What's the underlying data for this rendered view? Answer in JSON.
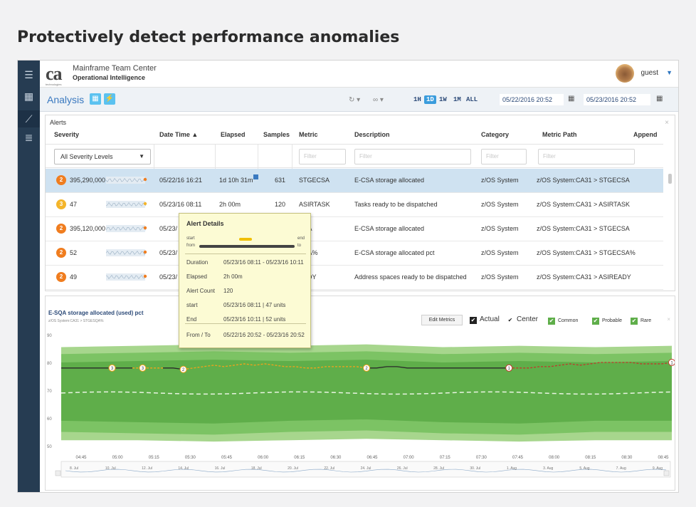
{
  "headline": "Protectively detect performance anomalies",
  "app": {
    "logo": "ca",
    "logo_sub": "technologies",
    "title_line1": "Mainframe Team Center",
    "title_line2": "Operational Intelligence",
    "user": "guest",
    "nav_icons": [
      "menu-icon",
      "grid-icon",
      "line-chart-icon",
      "filter-list-icon"
    ]
  },
  "subbar": {
    "title": "Analysis",
    "ranges": [
      "1H",
      "1D",
      "1W",
      "1M",
      "ALL"
    ],
    "active_range": "1D",
    "date_from": "05/22/2016 20:52",
    "date_to": "05/23/2016 20:52",
    "colors": {
      "accent": "#3a79c0",
      "active_range_bg": "#3a9cdc"
    }
  },
  "alerts": {
    "title": "Alerts",
    "columns": [
      "Severity",
      "Date Time",
      "Elapsed",
      "Samples",
      "Metric",
      "Description",
      "Category",
      "Metric Path",
      "Append"
    ],
    "sort_indicator": "▲",
    "severity_filter": "All Severity Levels",
    "filter_placeholder": "Filter",
    "rows": [
      {
        "level": "2",
        "value": "395,290,000",
        "datetime": "05/22/16 16:21",
        "elapsed": "1d 10h 31m",
        "samples": "631",
        "metric": "STGECSA",
        "description": "E-CSA storage allocated",
        "category": "z/OS System",
        "path": "z/OS System:CA31 > STGECSA"
      },
      {
        "level": "3",
        "value": "47",
        "datetime": "05/23/16 08:11",
        "elapsed": "2h 00m",
        "samples": "120",
        "metric": "ASIRTASK",
        "description": "Tasks ready to be dispatched",
        "category": "z/OS System",
        "path": "z/OS System:CA31 > ASIRTASK"
      },
      {
        "level": "2",
        "value": "395,120,000",
        "datetime": "05/23/",
        "elapsed": "",
        "samples": "",
        "metric": "CSA",
        "description": "E-CSA storage allocated",
        "category": "z/OS System",
        "path": "z/OS System:CA31 > STGECSA"
      },
      {
        "level": "2",
        "value": "52",
        "datetime": "05/23/",
        "elapsed": "",
        "samples": "",
        "metric": "CSA%",
        "description": "E-CSA storage allocated pct",
        "category": "z/OS System",
        "path": "z/OS System:CA31 > STGECSA%"
      },
      {
        "level": "2",
        "value": "49",
        "datetime": "05/23/",
        "elapsed": "",
        "samples": "",
        "metric": "EADY",
        "description": "Address spaces ready to be dispatched",
        "category": "z/OS System",
        "path": "z/OS System:CA31 > ASIREADY"
      }
    ],
    "severity_colors": {
      "2": "#f07d1f",
      "3": "#f4b52b"
    }
  },
  "alert_details": {
    "title": "Alert Details",
    "scale": {
      "start": "start",
      "from": "from",
      "end": "end",
      "to": "to"
    },
    "rows": [
      {
        "label": "Duration",
        "value": "05/23/16 08:11  - 05/23/16 10:11"
      },
      {
        "label": "Elapsed",
        "value": "2h 00m"
      },
      {
        "label": "Alert Count",
        "value": "120"
      },
      {
        "label": "start",
        "value": "05/23/16 08:11  |  47 units"
      },
      {
        "label": "End",
        "value": "05/23/16 10:11  |  52 units"
      },
      {
        "label": "From / To",
        "value": "05/22/16 20:52  - 05/23/16 20:52"
      }
    ]
  },
  "chart": {
    "title": "E-SQA storage allocated (used) pct",
    "subtitle": "z/OS System:CA31 > STGESQA%",
    "edit_label": "Edit Metrics",
    "legend": {
      "actual": "Actual",
      "center": "Center",
      "common": "Common",
      "probable": "Probable",
      "rare": "Rare"
    },
    "close": "×"
  },
  "chart_data": {
    "type": "line",
    "ylim": [
      50,
      90
    ],
    "yticks": [
      "90",
      "80",
      "70",
      "60",
      "50"
    ],
    "xticks": [
      "04:45",
      "05:00",
      "05:15",
      "05:30",
      "05:45",
      "06:00",
      "06:15",
      "06:30",
      "06:45",
      "07:00",
      "07:15",
      "07:30",
      "07:45",
      "08:00",
      "08:15",
      "08:30",
      "08:45"
    ],
    "overview_ticks": [
      "8. Jul",
      "10. Jul",
      "12. Jul",
      "14. Jul",
      "16. Jul",
      "18. Jul",
      "20. Jul",
      "22. Jul",
      "24. Jul",
      "26. Jul",
      "28. Jul",
      "30. Jul",
      "1. Aug",
      "3. Aug",
      "5. Aug",
      "7. Aug",
      "9. Aug"
    ],
    "actual": [
      78,
      78,
      78,
      78,
      78,
      78,
      78,
      78,
      78,
      78,
      78,
      78,
      77.5,
      78,
      78.5,
      79,
      78.5,
      79,
      79.5,
      79,
      79.5,
      79,
      78.5,
      78.5,
      78,
      78,
      78.5,
      78.5,
      78.5,
      78.5,
      78,
      78,
      78.5,
      78.5,
      78,
      78,
      78,
      78,
      78,
      78,
      78,
      78,
      78,
      78,
      78,
      78,
      78,
      78.5,
      78.5,
      79,
      79.5,
      79,
      79.5,
      80,
      80,
      80,
      80,
      79.5,
      79.5,
      79.5,
      80
    ],
    "alert_markers": [
      {
        "i": 13,
        "level": "3"
      },
      {
        "i": 17,
        "level": "3"
      },
      {
        "i": 20,
        "level": "2"
      },
      {
        "i": 49,
        "level": "2"
      },
      {
        "i": 87,
        "level": "1"
      },
      {
        "i": 103,
        "level": "1"
      }
    ],
    "colors": {
      "rare": "#a7d68d",
      "probable": "#7cc364",
      "common": "#5fae4a",
      "actual": "#2a2a2a",
      "alert_orange": "#f0a21a",
      "alert_red": "#c0392b"
    }
  }
}
